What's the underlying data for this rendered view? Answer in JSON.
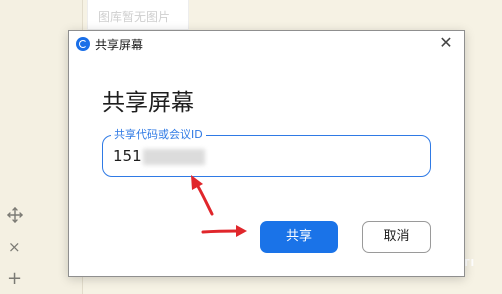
{
  "background": {
    "gallery_empty_text": "图库暂无图片",
    "tools": [
      "move-icon",
      "close-icon",
      "plus-icon"
    ],
    "x_glyph": "×",
    "plus_glyph": "+",
    "corner_text": "ITI"
  },
  "dialog": {
    "title": "共享屏幕",
    "close_glyph": "✕",
    "heading": "共享屏幕",
    "field_label": "共享代码或会议ID",
    "field_value": "151",
    "share_button": "共享",
    "cancel_button": "取消"
  },
  "colors": {
    "accent": "#1a73e8",
    "annotation_arrow": "#e0262b"
  }
}
